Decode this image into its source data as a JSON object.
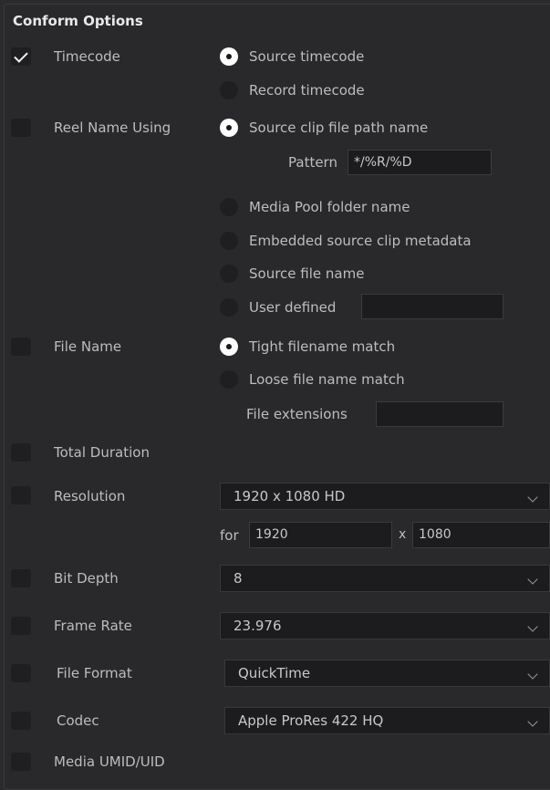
{
  "panel": {
    "title": "Conform Options"
  },
  "timecode": {
    "label": "Timecode",
    "checked": true,
    "options": [
      "Source timecode",
      "Record timecode"
    ],
    "selected": 0
  },
  "reel_name": {
    "label": "Reel Name Using",
    "checked": false,
    "options": [
      "Source clip file path name",
      "Media Pool folder name",
      "Embedded source clip metadata",
      "Source file name",
      "User defined"
    ],
    "selected": 0,
    "pattern_label": "Pattern",
    "pattern_value": "*/%R/%D",
    "user_defined_value": ""
  },
  "file_name": {
    "label": "File Name",
    "checked": false,
    "options": [
      "Tight filename match",
      "Loose file name match"
    ],
    "selected": 0,
    "extensions_label": "File extensions",
    "extensions_value": ""
  },
  "total_duration": {
    "label": "Total Duration",
    "checked": false
  },
  "resolution": {
    "label": "Resolution",
    "checked": false,
    "value": "1920 x 1080 HD",
    "for_label": "for",
    "width": "1920",
    "x_label": "x",
    "height": "1080"
  },
  "bit_depth": {
    "label": "Bit Depth",
    "checked": false,
    "value": "8"
  },
  "frame_rate": {
    "label": "Frame Rate",
    "checked": false,
    "value": "23.976"
  },
  "file_format": {
    "label": "File Format",
    "checked": false,
    "value": "QuickTime"
  },
  "codec": {
    "label": "Codec",
    "checked": false,
    "value": "Apple ProRes 422 HQ"
  },
  "media_umid": {
    "label": "Media UMID/UID",
    "checked": false
  }
}
